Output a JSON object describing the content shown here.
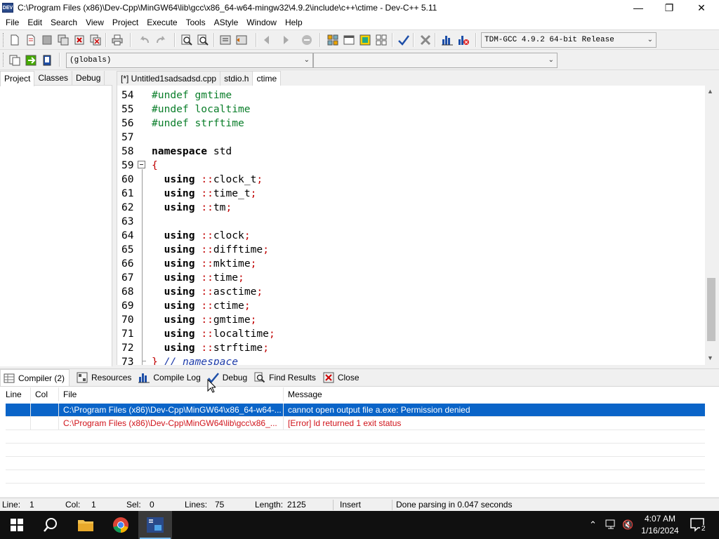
{
  "window": {
    "title": "C:\\Program Files (x86)\\Dev-Cpp\\MinGW64\\lib\\gcc\\x86_64-w64-mingw32\\4.9.2\\include\\c++\\ctime - Dev-C++ 5.11",
    "app_icon_text": "DEV",
    "minimize": "—",
    "maximize": "❐",
    "close": "✕"
  },
  "menu": [
    "File",
    "Edit",
    "Search",
    "View",
    "Project",
    "Execute",
    "Tools",
    "AStyle",
    "Window",
    "Help"
  ],
  "toolbar": {
    "compiler_select": "TDM-GCC 4.9.2 64-bit Release",
    "scope_select": "(globals)",
    "member_select": ""
  },
  "left_tabs": [
    "Project",
    "Classes",
    "Debug"
  ],
  "editor_tabs": [
    "[*] Untitled1sadsadsd.cpp",
    "stdio.h",
    "ctime"
  ],
  "code_lines": [
    {
      "num": "54",
      "parts": [
        {
          "t": "#undef gmtime",
          "c": "pp"
        }
      ]
    },
    {
      "num": "55",
      "parts": [
        {
          "t": "#undef localtime",
          "c": "pp"
        }
      ]
    },
    {
      "num": "56",
      "parts": [
        {
          "t": "#undef strftime",
          "c": "pp"
        }
      ]
    },
    {
      "num": "57",
      "parts": []
    },
    {
      "num": "58",
      "parts": [
        {
          "t": "namespace",
          "c": "kw"
        },
        {
          "t": " std",
          "c": ""
        }
      ]
    },
    {
      "num": "59",
      "parts": [
        {
          "t": "{",
          "c": "sym"
        }
      ]
    },
    {
      "num": "60",
      "parts": [
        {
          "t": "  ",
          "c": ""
        },
        {
          "t": "using",
          "c": "kw"
        },
        {
          "t": " ",
          "c": ""
        },
        {
          "t": "::",
          "c": "sym"
        },
        {
          "t": "clock_t",
          "c": ""
        },
        {
          "t": ";",
          "c": "sym"
        }
      ]
    },
    {
      "num": "61",
      "parts": [
        {
          "t": "  ",
          "c": ""
        },
        {
          "t": "using",
          "c": "kw"
        },
        {
          "t": " ",
          "c": ""
        },
        {
          "t": "::",
          "c": "sym"
        },
        {
          "t": "time_t",
          "c": ""
        },
        {
          "t": ";",
          "c": "sym"
        }
      ]
    },
    {
      "num": "62",
      "parts": [
        {
          "t": "  ",
          "c": ""
        },
        {
          "t": "using",
          "c": "kw"
        },
        {
          "t": " ",
          "c": ""
        },
        {
          "t": "::",
          "c": "sym"
        },
        {
          "t": "tm",
          "c": ""
        },
        {
          "t": ";",
          "c": "sym"
        }
      ]
    },
    {
      "num": "63",
      "parts": []
    },
    {
      "num": "64",
      "parts": [
        {
          "t": "  ",
          "c": ""
        },
        {
          "t": "using",
          "c": "kw"
        },
        {
          "t": " ",
          "c": ""
        },
        {
          "t": "::",
          "c": "sym"
        },
        {
          "t": "clock",
          "c": ""
        },
        {
          "t": ";",
          "c": "sym"
        }
      ]
    },
    {
      "num": "65",
      "parts": [
        {
          "t": "  ",
          "c": ""
        },
        {
          "t": "using",
          "c": "kw"
        },
        {
          "t": " ",
          "c": ""
        },
        {
          "t": "::",
          "c": "sym"
        },
        {
          "t": "difftime",
          "c": ""
        },
        {
          "t": ";",
          "c": "sym"
        }
      ]
    },
    {
      "num": "66",
      "parts": [
        {
          "t": "  ",
          "c": ""
        },
        {
          "t": "using",
          "c": "kw"
        },
        {
          "t": " ",
          "c": ""
        },
        {
          "t": "::",
          "c": "sym"
        },
        {
          "t": "mktime",
          "c": ""
        },
        {
          "t": ";",
          "c": "sym"
        }
      ]
    },
    {
      "num": "67",
      "parts": [
        {
          "t": "  ",
          "c": ""
        },
        {
          "t": "using",
          "c": "kw"
        },
        {
          "t": " ",
          "c": ""
        },
        {
          "t": "::",
          "c": "sym"
        },
        {
          "t": "time",
          "c": ""
        },
        {
          "t": ";",
          "c": "sym"
        }
      ]
    },
    {
      "num": "68",
      "parts": [
        {
          "t": "  ",
          "c": ""
        },
        {
          "t": "using",
          "c": "kw"
        },
        {
          "t": " ",
          "c": ""
        },
        {
          "t": "::",
          "c": "sym"
        },
        {
          "t": "asctime",
          "c": ""
        },
        {
          "t": ";",
          "c": "sym"
        }
      ]
    },
    {
      "num": "69",
      "parts": [
        {
          "t": "  ",
          "c": ""
        },
        {
          "t": "using",
          "c": "kw"
        },
        {
          "t": " ",
          "c": ""
        },
        {
          "t": "::",
          "c": "sym"
        },
        {
          "t": "ctime",
          "c": ""
        },
        {
          "t": ";",
          "c": "sym"
        }
      ]
    },
    {
      "num": "70",
      "parts": [
        {
          "t": "  ",
          "c": ""
        },
        {
          "t": "using",
          "c": "kw"
        },
        {
          "t": " ",
          "c": ""
        },
        {
          "t": "::",
          "c": "sym"
        },
        {
          "t": "gmtime",
          "c": ""
        },
        {
          "t": ";",
          "c": "sym"
        }
      ]
    },
    {
      "num": "71",
      "parts": [
        {
          "t": "  ",
          "c": ""
        },
        {
          "t": "using",
          "c": "kw"
        },
        {
          "t": " ",
          "c": ""
        },
        {
          "t": "::",
          "c": "sym"
        },
        {
          "t": "localtime",
          "c": ""
        },
        {
          "t": ";",
          "c": "sym"
        }
      ]
    },
    {
      "num": "72",
      "parts": [
        {
          "t": "  ",
          "c": ""
        },
        {
          "t": "using",
          "c": "kw"
        },
        {
          "t": " ",
          "c": ""
        },
        {
          "t": "::",
          "c": "sym"
        },
        {
          "t": "strftime",
          "c": ""
        },
        {
          "t": ";",
          "c": "sym"
        }
      ]
    },
    {
      "num": "73",
      "parts": [
        {
          "t": "}",
          "c": "sym"
        },
        {
          "t": " // namespace",
          "c": "cm"
        }
      ]
    }
  ],
  "bottom_tabs": [
    "Compiler (2)",
    "Resources",
    "Compile Log",
    "Debug",
    "Find Results",
    "Close"
  ],
  "messages": {
    "headers": [
      "Line",
      "Col",
      "File",
      "Message"
    ],
    "rows": [
      {
        "line": "",
        "col": "",
        "file": "C:\\Program Files (x86)\\Dev-Cpp\\MinGW64\\x86_64-w64-...",
        "message": "cannot open output file a.exe: Permission denied"
      },
      {
        "line": "",
        "col": "",
        "file": "C:\\Program Files (x86)\\Dev-Cpp\\MinGW64\\lib\\gcc\\x86_...",
        "message": "[Error] ld returned 1 exit status"
      }
    ]
  },
  "status": {
    "line_label": "Line:",
    "line_value": "1",
    "col_label": "Col:",
    "col_value": "1",
    "sel_label": "Sel:",
    "sel_value": "0",
    "lines_label": "Lines:",
    "lines_value": "75",
    "length_label": "Length:",
    "length_value": "2125",
    "mode": "Insert",
    "message": "Done parsing in 0.047 seconds"
  },
  "taskbar": {
    "time": "4:07 AM",
    "date": "1/16/2024",
    "notification_count": "2"
  },
  "colors": {
    "selection": "#0a64c8",
    "error_text": "#d0131a",
    "preprocessor": "#0a7e2a",
    "symbol": "#c00000",
    "comment": "#1c3aa9"
  }
}
